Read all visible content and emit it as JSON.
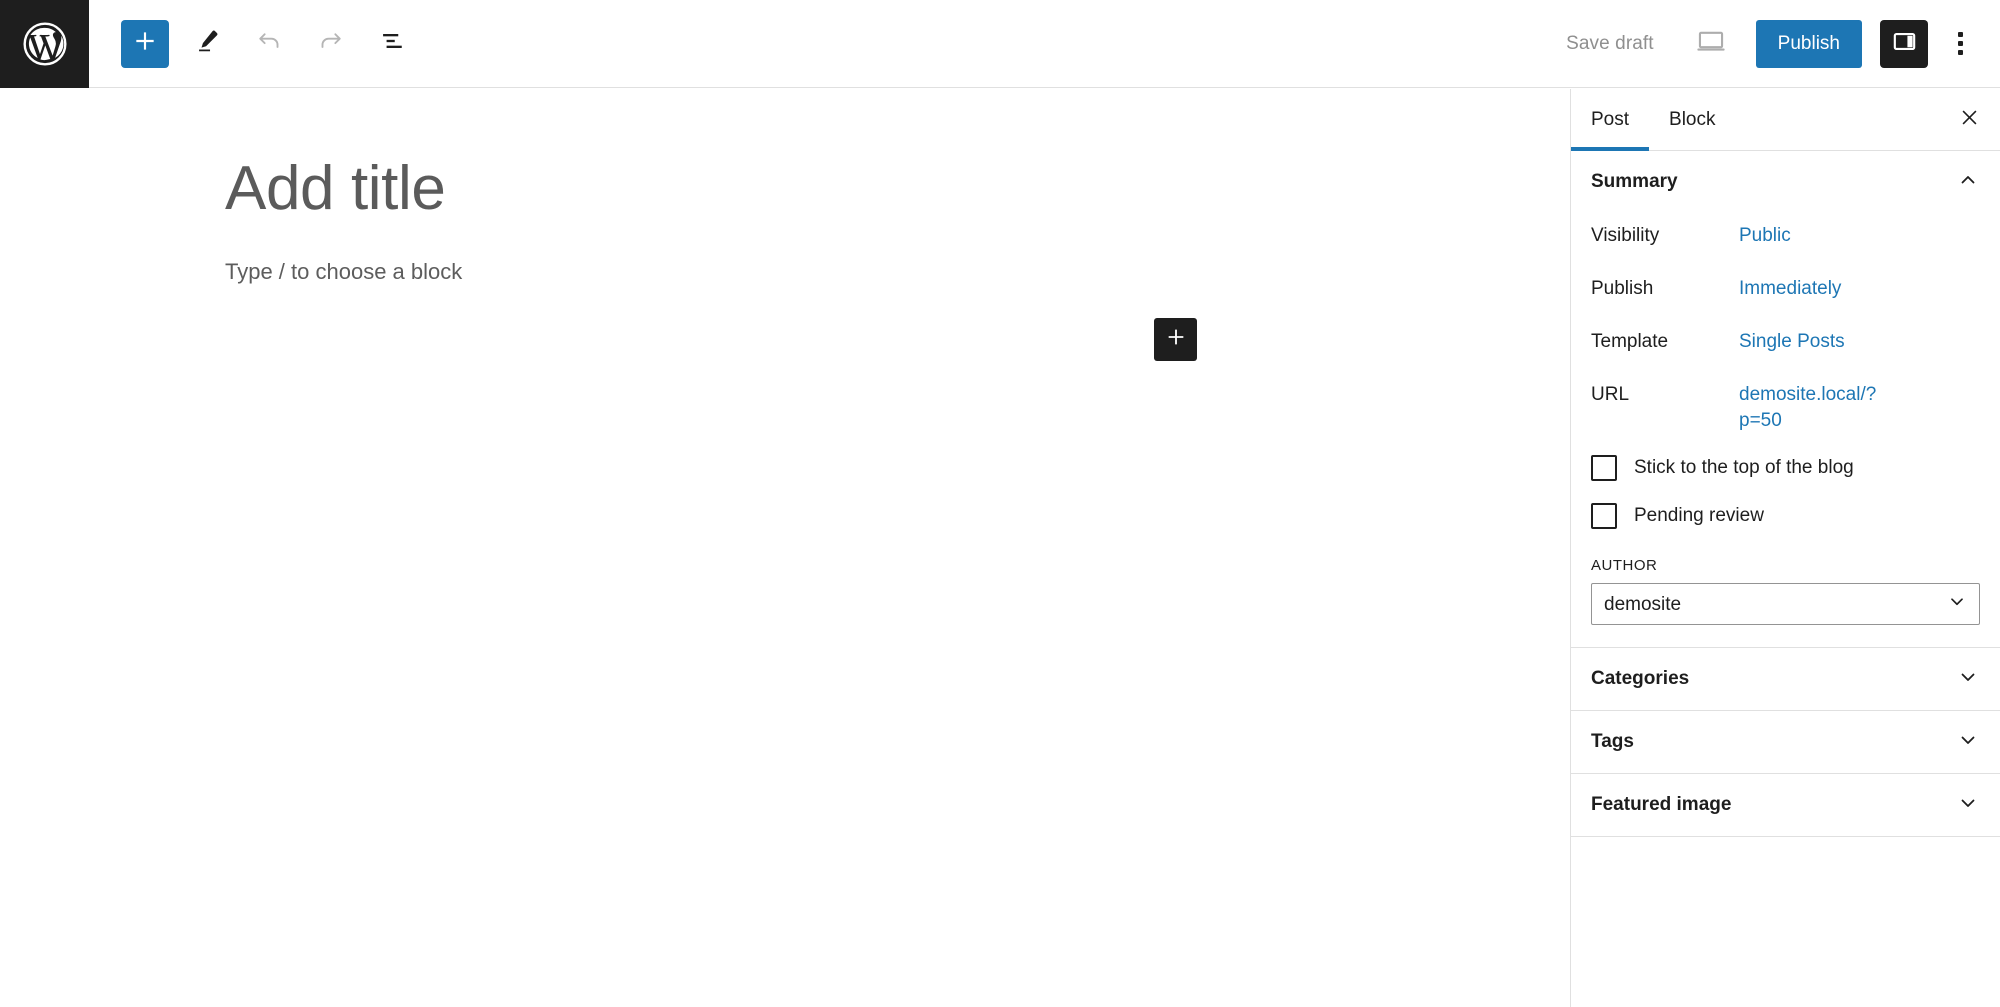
{
  "header": {
    "logo_icon": "wordpress-logo-icon",
    "toolbar": [
      {
        "name": "add-block-button",
        "icon": "plus-icon",
        "state": "active"
      },
      {
        "name": "edit-mode-button",
        "icon": "pencil-icon",
        "state": "default"
      },
      {
        "name": "undo-button",
        "icon": "undo-arrow-icon",
        "state": "disabled"
      },
      {
        "name": "redo-button",
        "icon": "redo-arrow-icon",
        "state": "disabled"
      },
      {
        "name": "list-view-button",
        "icon": "list-view-icon",
        "state": "default"
      }
    ],
    "save_draft_label": "Save draft",
    "preview_icon": "desktop-preview-icon",
    "publish_label": "Publish",
    "sidebar_toggle_icon": "settings-sidebar-icon",
    "more_menu_icon": "three-dots-vertical-icon",
    "accent_color": "#1d76b4",
    "dark_color": "#1e1e1e"
  },
  "editor": {
    "title_placeholder": "Add title",
    "block_placeholder": "Type / to choose a block",
    "inserter_icon": "plus-icon"
  },
  "sidebar": {
    "tabs": [
      {
        "label": "Post",
        "active": true
      },
      {
        "label": "Block",
        "active": false
      }
    ],
    "close_icon": "close-icon",
    "summary": {
      "title": "Summary",
      "expanded": true,
      "toggle_icon": "chevron-up-icon",
      "rows": [
        {
          "label": "Visibility",
          "value": "Public"
        },
        {
          "label": "Publish",
          "value": "Immediately"
        },
        {
          "label": "Template",
          "value": "Single Posts"
        },
        {
          "label": "URL",
          "value": "demosite.local/?p=50"
        }
      ],
      "checkboxes": [
        {
          "label": "Stick to the top of the blog",
          "checked": false
        },
        {
          "label": "Pending review",
          "checked": false
        }
      ],
      "author_field_label": "AUTHOR",
      "author_value": "demosite",
      "author_options": [
        "demosite"
      ],
      "author_chevron_icon": "chevron-down-icon"
    },
    "panels": [
      {
        "title": "Categories",
        "expanded": false,
        "toggle_icon": "chevron-down-icon"
      },
      {
        "title": "Tags",
        "expanded": false,
        "toggle_icon": "chevron-down-icon"
      },
      {
        "title": "Featured image",
        "expanded": false,
        "toggle_icon": "chevron-down-icon"
      }
    ]
  }
}
